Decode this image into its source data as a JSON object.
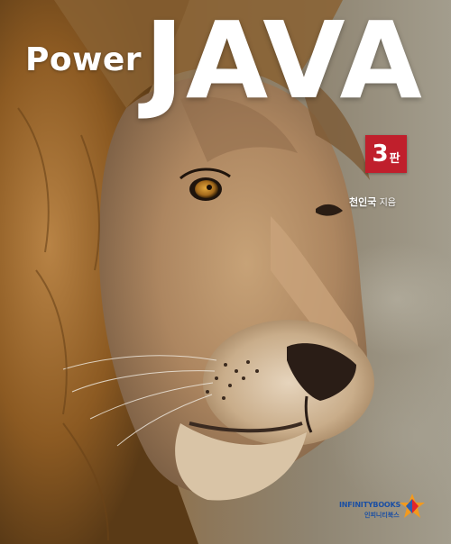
{
  "cover": {
    "title_prefix": "Power",
    "title_main": "JAVA",
    "edition_number": "3",
    "edition_suffix": "판",
    "author_name": "천인국",
    "author_role": "지음",
    "publisher_en": "INFINITYBOOKS",
    "publisher_ko": "인피니티북스"
  },
  "colors": {
    "title": "#ffffff",
    "edition_badge": "#c01f2c",
    "publisher_text": "#1b4fa3",
    "logo_orange": "#f39a1e",
    "logo_red": "#e2262b",
    "logo_blue": "#2a5db0"
  },
  "icons": {
    "cover_photo": "lion-photo",
    "publisher_logo": "infinitybooks-star-logo"
  }
}
